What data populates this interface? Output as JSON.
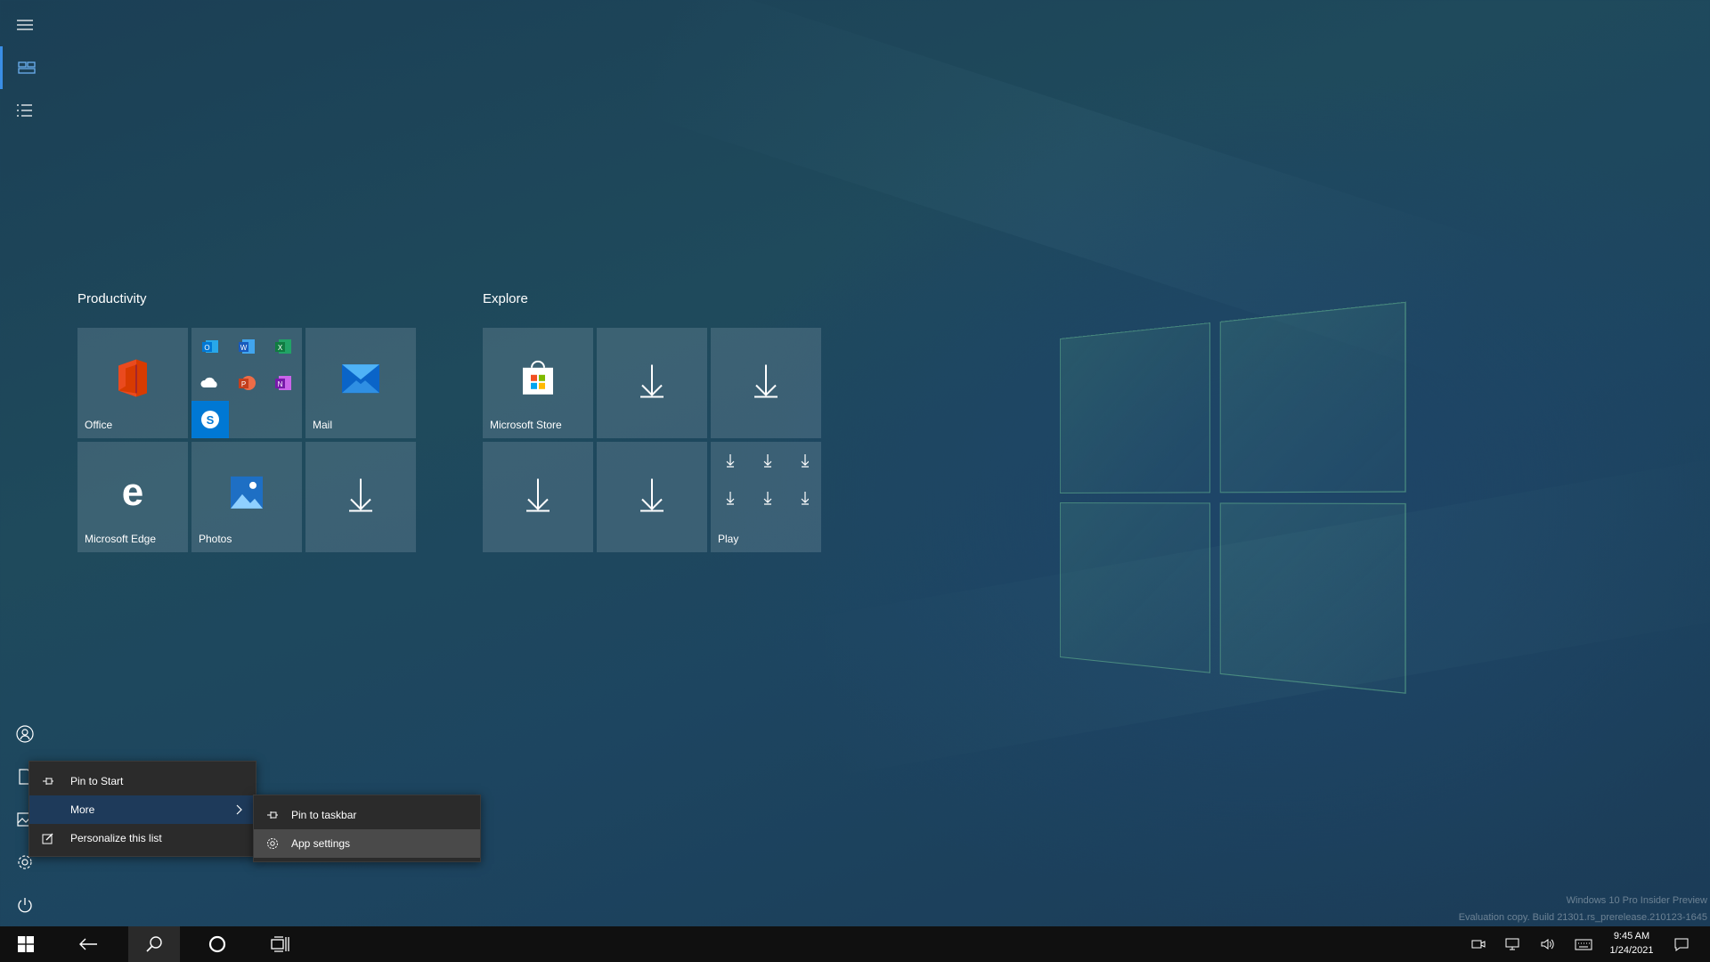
{
  "desktop": {
    "watermark_line1": "Windows 10 Pro Insider Preview",
    "watermark_line2": "Evaluation copy. Build 21301.rs_prerelease.210123-1645"
  },
  "start": {
    "rail_icons": [
      "hamburger-menu-icon",
      "pinned-tiles-icon",
      "all-apps-list-icon",
      "user-account-icon",
      "documents-icon",
      "pictures-icon",
      "settings-gear-icon",
      "power-icon"
    ],
    "groups": [
      {
        "title": "Productivity",
        "tiles": [
          {
            "label": "Office",
            "icon": "office-icon"
          },
          {
            "label": "",
            "icon": "office-apps-folder-icon",
            "apps": [
              "outlook-icon",
              "word-icon",
              "excel-icon",
              "onedrive-icon",
              "powerpoint-icon",
              "onenote-icon",
              "skype-icon"
            ]
          },
          {
            "label": "Mail",
            "icon": "mail-icon"
          },
          {
            "label": "Microsoft Edge",
            "icon": "edge-icon"
          },
          {
            "label": "Photos",
            "icon": "photos-icon"
          },
          {
            "label": "",
            "icon": "download-arrow-icon"
          }
        ]
      },
      {
        "title": "Explore",
        "tiles": [
          {
            "label": "Microsoft Store",
            "icon": "store-bag-icon"
          },
          {
            "label": "",
            "icon": "download-arrow-icon"
          },
          {
            "label": "",
            "icon": "download-arrow-icon"
          },
          {
            "label": "",
            "icon": "download-arrow-icon"
          },
          {
            "label": "",
            "icon": "download-arrow-icon"
          },
          {
            "label": "Play",
            "icon": "play-folder-icon"
          }
        ]
      }
    ]
  },
  "context_menu": {
    "items": [
      {
        "label": "Pin to Start",
        "icon": "pin-icon"
      },
      {
        "label": "More",
        "icon": "",
        "has_submenu": true
      },
      {
        "label": "Personalize this list",
        "icon": "personalize-icon"
      }
    ]
  },
  "submenu": {
    "items": [
      {
        "label": "Pin to taskbar",
        "icon": "pin-icon"
      },
      {
        "label": "App settings",
        "icon": "gear-icon"
      }
    ]
  },
  "taskbar": {
    "buttons": [
      "start-windows-icon",
      "back-arrow-icon",
      "search-icon",
      "cortana-circle-icon",
      "task-view-icon"
    ],
    "tray": [
      "meet-now-icon",
      "network-icon",
      "volume-icon",
      "keyboard-icon",
      "notification-icon"
    ],
    "time": "9:45 AM",
    "date": "1/24/2021"
  }
}
